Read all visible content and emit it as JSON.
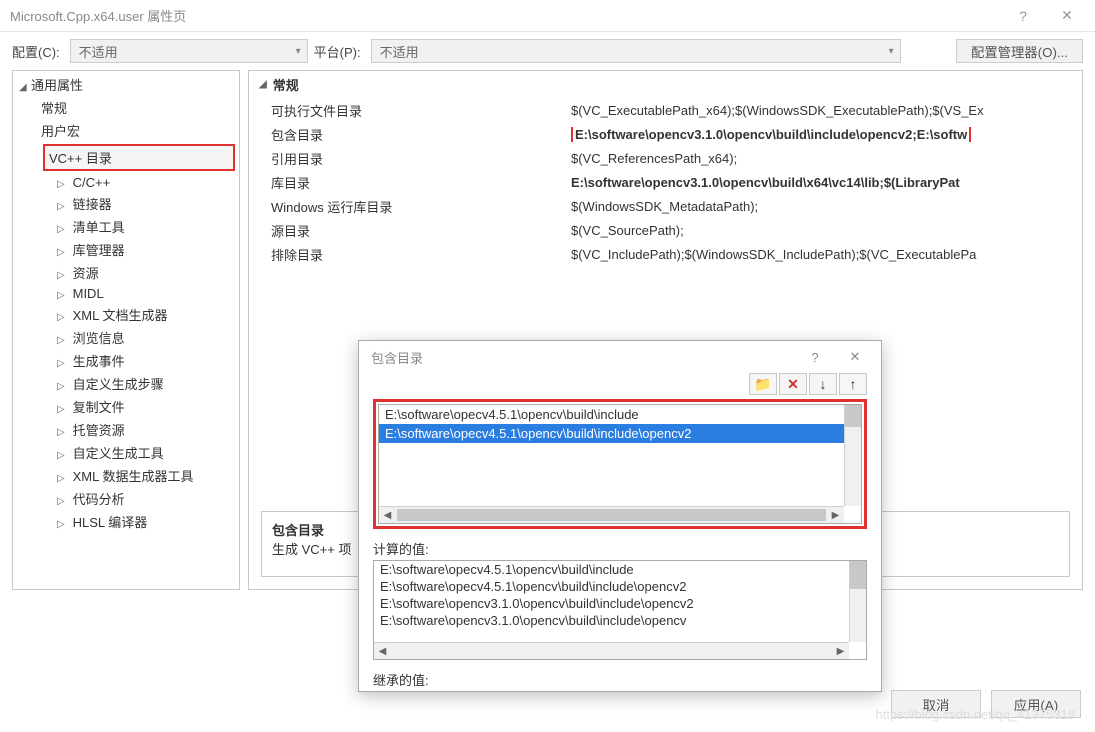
{
  "window": {
    "title": "Microsoft.Cpp.x64.user 属性页"
  },
  "toolbar": {
    "config_label": "配置(C):",
    "config_value": "不适用",
    "platform_label": "平台(P):",
    "platform_value": "不适用",
    "config_manager": "配置管理器(O)..."
  },
  "tree": {
    "root": "通用属性",
    "items": [
      "常规",
      "用户宏",
      "VC++ 目录",
      "C/C++",
      "链接器",
      "清单工具",
      "库管理器",
      "资源",
      "MIDL",
      "XML 文档生成器",
      "浏览信息",
      "生成事件",
      "自定义生成步骤",
      "复制文件",
      "托管资源",
      "自定义生成工具",
      "XML 数据生成器工具",
      "代码分析",
      "HLSL 编译器"
    ],
    "selected_index": 2
  },
  "content": {
    "header": "常规",
    "rows": [
      {
        "label": "可执行文件目录",
        "value": "$(VC_ExecutablePath_x64);$(WindowsSDK_ExecutablePath);$(VS_Ex",
        "bold": false
      },
      {
        "label": "包含目录",
        "value": "E:\\software\\opencv3.1.0\\opencv\\build\\include\\opencv2;E:\\softw",
        "bold": true,
        "highlight": true
      },
      {
        "label": "引用目录",
        "value": "$(VC_ReferencesPath_x64);",
        "bold": false
      },
      {
        "label": "库目录",
        "value": "E:\\software\\opencv3.1.0\\opencv\\build\\x64\\vc14\\lib;$(LibraryPat",
        "bold": true
      },
      {
        "label": "Windows 运行库目录",
        "value": "$(WindowsSDK_MetadataPath);",
        "bold": false
      },
      {
        "label": "源目录",
        "value": "$(VC_SourcePath);",
        "bold": false
      },
      {
        "label": "排除目录",
        "value": "$(VC_IncludePath);$(WindowsSDK_IncludePath);$(VC_ExecutablePa",
        "bold": false
      }
    ]
  },
  "description": {
    "title": "包含目录",
    "body": "生成 VC++ 项"
  },
  "footer": {
    "cancel": "取消",
    "apply": "应用(A)"
  },
  "popup": {
    "title": "包含目录",
    "toolbar_icons": [
      "folder-new-icon",
      "delete-icon",
      "move-down-icon",
      "move-up-icon"
    ],
    "list": [
      "E:\\software\\opecv4.5.1\\opencv\\build\\include",
      "E:\\software\\opecv4.5.1\\opencv\\build\\include\\opencv2"
    ],
    "list_selected_index": 1,
    "computed_label": "计算的值:",
    "computed": [
      "E:\\software\\opecv4.5.1\\opencv\\build\\include",
      "E:\\software\\opecv4.5.1\\opencv\\build\\include\\opencv2",
      "E:\\software\\opencv3.1.0\\opencv\\build\\include\\opencv2",
      "E:\\software\\opencv3.1.0\\opencv\\build\\include\\opencv"
    ],
    "inherited_label": "继承的值:"
  },
  "watermark": "https://blog.csdn.net/qq_41375318"
}
